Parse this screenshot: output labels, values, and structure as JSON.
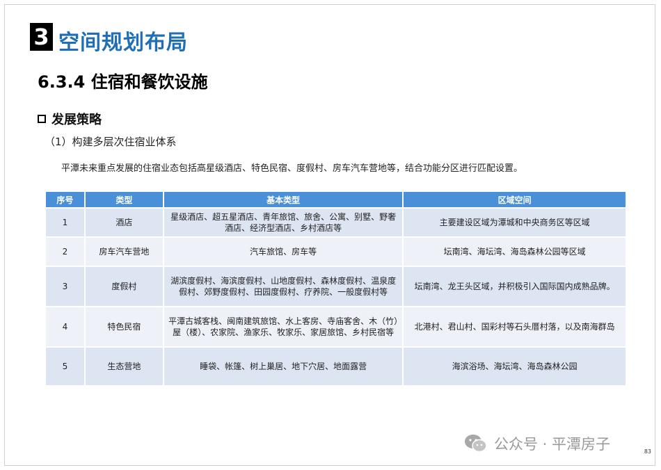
{
  "section": {
    "number": "3",
    "title": "空间规划布局"
  },
  "subsection": {
    "title": "6.3.4  住宿和餐饮设施"
  },
  "strategy": {
    "label": "发展策略"
  },
  "item": {
    "heading": "（1）构建多层次住宿业体系"
  },
  "intro": "平潭未来重点发展的住宿业态包括高星级酒店、特色民宿、度假村、房车汽车营地等，结合功能分区进行匹配设置。",
  "table": {
    "headers": [
      "序号",
      "类型",
      "基本类型",
      "区域空间"
    ],
    "rows": [
      {
        "no": "1",
        "type": "酒店",
        "basic": "星级酒店、超五星酒店、青年旅馆、旅舍、公寓、别墅、野奢酒店、经济型酒店、乡村酒店等",
        "region": "主要建设区域为潭城和中央商务区等区域"
      },
      {
        "no": "2",
        "type": "房车汽车营地",
        "basic": "汽车旅馆、房车等",
        "region": "坛南湾、海坛湾、海岛森林公园等区域"
      },
      {
        "no": "3",
        "type": "度假村",
        "basic": "湖滨度假村、海滨度假村、山地度假村、森林度假村、温泉度假村、郊野度假村、田园度假村、疗养院、一般度假村等",
        "region": "坛南湾、龙王头区域，并积极引入国际国内成熟品牌。"
      },
      {
        "no": "4",
        "type": "特色民宿",
        "basic": "平潭古城客栈、闽南建筑旅馆、水上客房、寺庙客舍、木（竹）屋（楼）、农家院、渔家乐、牧家乐、家居旅馆、乡村民宿等",
        "region": "北港村、君山村、国彩村等石头厝村落，以及南海群岛"
      },
      {
        "no": "5",
        "type": "生态营地",
        "basic": "睡袋、帐篷、树上巢居、地下穴居、地面露营",
        "region": "海滨浴场、海坛湾、海岛森林公园"
      }
    ]
  },
  "watermark": {
    "text": "公众号 · 平潭房子",
    "icon": "wechat-icon"
  },
  "page_number": "83",
  "colors": {
    "title_blue": "#1f6fb7",
    "header_blue": "#4a90d9",
    "row_a": "#dde5f2",
    "row_b": "#eef1f8"
  }
}
